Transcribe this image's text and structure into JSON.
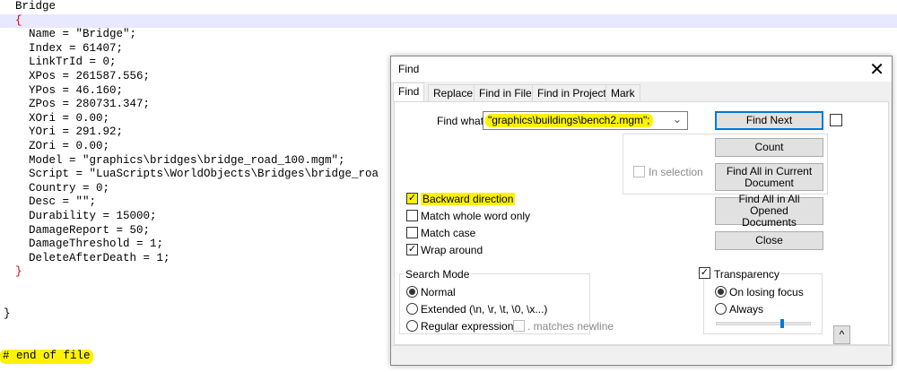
{
  "editor": {
    "lines": [
      "Bridge",
      "{",
      "Name = \"Bridge\";",
      "Index = 61407;",
      "LinkTrId = 0;",
      "XPos = 261587.556;",
      "YPos = 46.160;",
      "ZPos = 280731.347;",
      "XOri = 0.00;",
      "YOri = 291.92;",
      "ZOri = 0.00;",
      "Model = \"graphics\\bridges\\bridge_road_100.mgm\";",
      "Script = \"LuaScripts\\WorldObjects\\Bridges\\bridge_roa",
      "Country = 0;",
      "Desc = \"\";",
      "Durability = 15000;",
      "DamageReport = 50;",
      "DamageThreshold = 1;",
      "DeleteAfterDeath = 1;",
      "}",
      "",
      "",
      "}",
      "",
      "",
      "# end of file"
    ],
    "highlight_color": "#fff200"
  },
  "dialog": {
    "title": "Find",
    "close": "✕",
    "tabs": [
      "Find",
      "Replace",
      "Find in Files",
      "Find in Projects",
      "Mark"
    ],
    "find_what_label": "Find what :",
    "find_what_value": "\"graphics\\buildings\\bench2.mgm\";",
    "buttons": {
      "find_next": "Find Next",
      "count": "Count",
      "find_all_current": "Find All in Current Document",
      "find_all_opened": "Find All in All Opened Documents",
      "close": "Close",
      "collapse": "^"
    },
    "in_selection": "In selection",
    "options": [
      {
        "label": "Backward direction",
        "checked": true
      },
      {
        "label": "Match whole word only",
        "checked": false
      },
      {
        "label": "Match case",
        "checked": false
      },
      {
        "label": "Wrap around",
        "checked": true
      }
    ],
    "search_mode": {
      "title": "Search Mode",
      "options": [
        "Normal",
        "Extended (\\n, \\r, \\t, \\0, \\x...)",
        "Regular expression"
      ],
      "selected": "Normal",
      "matches_newline": ". matches newline"
    },
    "transparency": {
      "title": "Transparency",
      "checked": true,
      "options": [
        "On losing focus",
        "Always"
      ],
      "selected": "On losing focus",
      "slider_value_percent": 70
    },
    "accent_color": "#0078d7"
  }
}
